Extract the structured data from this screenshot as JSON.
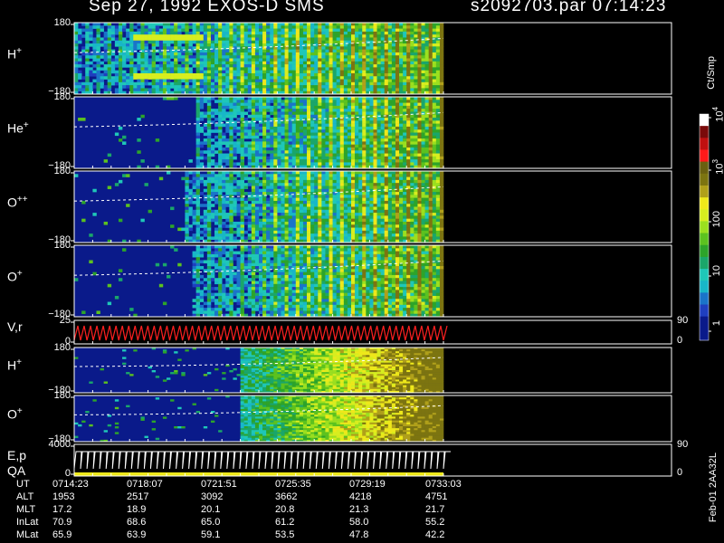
{
  "header": {
    "left": "Sep 27, 1992   EXOS-D SMS",
    "right": "s2092703.par  07:14:23"
  },
  "colors": {
    "background": "#000000",
    "axis": "#ffffff",
    "velocity_trace": "#ff2020"
  },
  "chart_data": {
    "type": "heatmap",
    "time_range": [
      "07:14:23",
      "07:33:03"
    ],
    "data_end_fraction": 1.0,
    "panels": [
      {
        "label": "H",
        "charge": "+",
        "ylim": [
          -180,
          180
        ],
        "top_tick": "180",
        "bottom_tick": "−180",
        "kind": "angle",
        "onset": 0.0
      },
      {
        "label": "He",
        "charge": "+",
        "ylim": [
          -180,
          180
        ],
        "top_tick": "180",
        "bottom_tick": "−180",
        "kind": "angle",
        "onset": 0.33
      },
      {
        "label": "O",
        "charge": "++",
        "ylim": [
          -180,
          180
        ],
        "top_tick": "180",
        "bottom_tick": "−180",
        "kind": "angle",
        "onset": 0.3
      },
      {
        "label": "O",
        "charge": "+",
        "ylim": [
          -180,
          180
        ],
        "top_tick": "180",
        "bottom_tick": "−180",
        "kind": "angle",
        "onset": 0.32
      },
      {
        "label": "V,r",
        "charge": "",
        "ylim": [
          0,
          25
        ],
        "top_tick": "25",
        "bottom_tick": "0",
        "right_top": "90",
        "right_bottom": "0",
        "kind": "trace"
      },
      {
        "label": "H",
        "charge": "+",
        "ylim": [
          -180,
          180
        ],
        "top_tick": "180",
        "bottom_tick": "−180",
        "kind": "energy",
        "onset": 0.45
      },
      {
        "label": "O",
        "charge": "+",
        "ylim": [
          -180,
          180
        ],
        "top_tick": "180",
        "bottom_tick": "−180",
        "kind": "energy",
        "onset": 0.45
      },
      {
        "label": "E,p",
        "label2": "QA",
        "charge": "",
        "ylim": [
          0,
          4000
        ],
        "top_tick": "4000",
        "bottom_tick": "0",
        "right_top": "90",
        "right_bottom": "0",
        "kind": "sweep"
      }
    ],
    "colorbar": {
      "unit": "Ct/Smp",
      "scale": "log",
      "tick_labels": [
        "1",
        "10",
        "100",
        "10",
        "10"
      ],
      "tick_exponents": [
        "",
        "",
        "",
        "3",
        "4"
      ],
      "tick_values": [
        1,
        10,
        100,
        1000,
        10000
      ],
      "stops": [
        "#0a1a8a",
        "#0a1a8a",
        "#1f3fbf",
        "#1a74c9",
        "#18b7c8",
        "#1fc7b8",
        "#1aa66a",
        "#2da42a",
        "#5cc21f",
        "#9be01f",
        "#d7ee1f",
        "#eee81a",
        "#b0a01a",
        "#7c7410",
        "#6a6010",
        "#ff1a1a",
        "#c01010",
        "#7a0a0a",
        "#ffffff"
      ]
    },
    "ephemeris": {
      "rows": [
        {
          "label": "UT",
          "values": [
            "0714:23",
            "0718:07",
            "0721:51",
            "0725:35",
            "0729:19",
            "0733:03"
          ]
        },
        {
          "label": "ALT",
          "values": [
            "1953",
            "2517",
            "3092",
            "3662",
            "4218",
            "4751"
          ]
        },
        {
          "label": "MLT",
          "values": [
            "17.2",
            "18.9",
            "20.1",
            "20.8",
            "21.3",
            "21.7"
          ]
        },
        {
          "label": "InLat",
          "values": [
            "70.9",
            "68.6",
            "65.0",
            "61.2",
            "58.0",
            "55.2"
          ]
        },
        {
          "label": "MLat",
          "values": [
            "65.9",
            "63.9",
            "59.1",
            "53.5",
            "47.8",
            "42.2"
          ]
        }
      ]
    },
    "footer_stamp": "Feb-01 2AA32L"
  }
}
